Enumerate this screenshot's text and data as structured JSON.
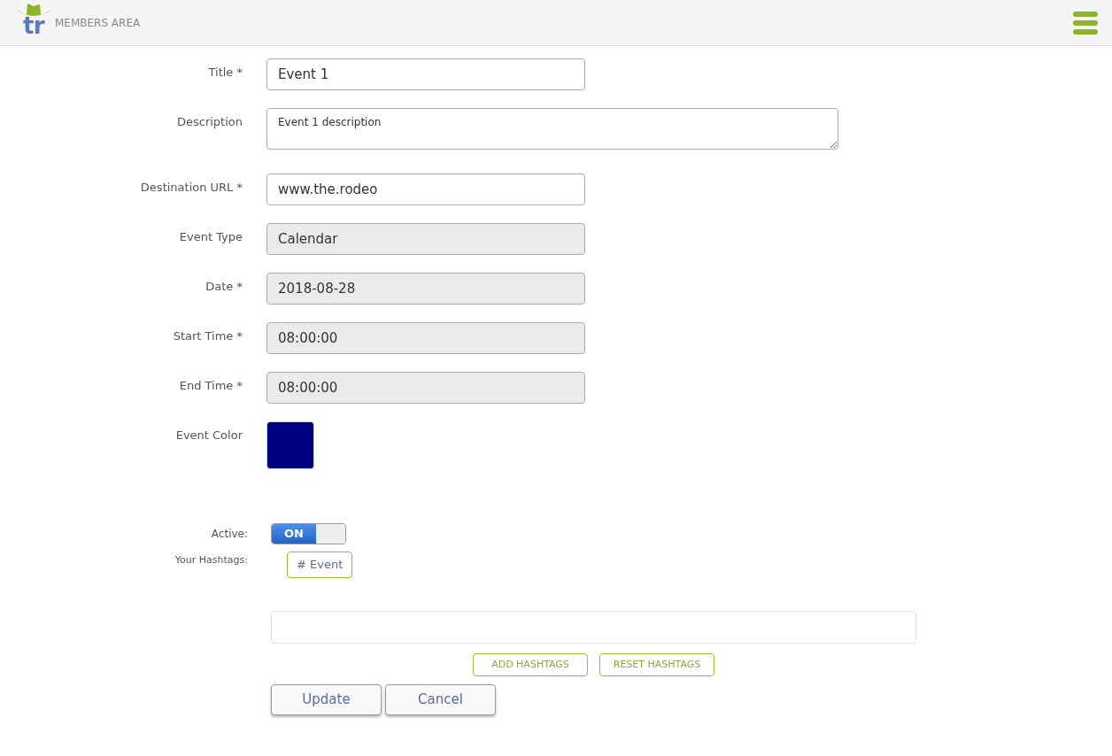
{
  "header": {
    "logo_text": "tr",
    "title": "MEMBERS AREA"
  },
  "fields": [
    {
      "kind": "text",
      "label": "Title *",
      "value": "Event 1"
    },
    {
      "kind": "textarea",
      "label": "Description",
      "value": "Event 1 description"
    },
    {
      "kind": "text",
      "label": "Destination URL *",
      "value": "www.the.rodeo"
    },
    {
      "kind": "readonly",
      "label": "Event Type",
      "value": "Calendar"
    },
    {
      "kind": "readonly",
      "label": "Date *",
      "value": "2018-08-28"
    },
    {
      "kind": "readonly",
      "label": "Start Time *",
      "value": "08:00:00"
    },
    {
      "kind": "readonly",
      "label": "End Time *",
      "value": "08:00:00"
    },
    {
      "kind": "color",
      "label": "Event Color",
      "color": "#000080"
    }
  ],
  "active": {
    "label": "Active:",
    "on": true,
    "text": "ON"
  },
  "hashtags": {
    "label": "Your Hashtags:",
    "items": [
      "# Event"
    ],
    "add": "ADD HASHTAGS",
    "reset": "RESET HASHTAGS"
  },
  "buttons": [
    "Update",
    "Cancel"
  ]
}
